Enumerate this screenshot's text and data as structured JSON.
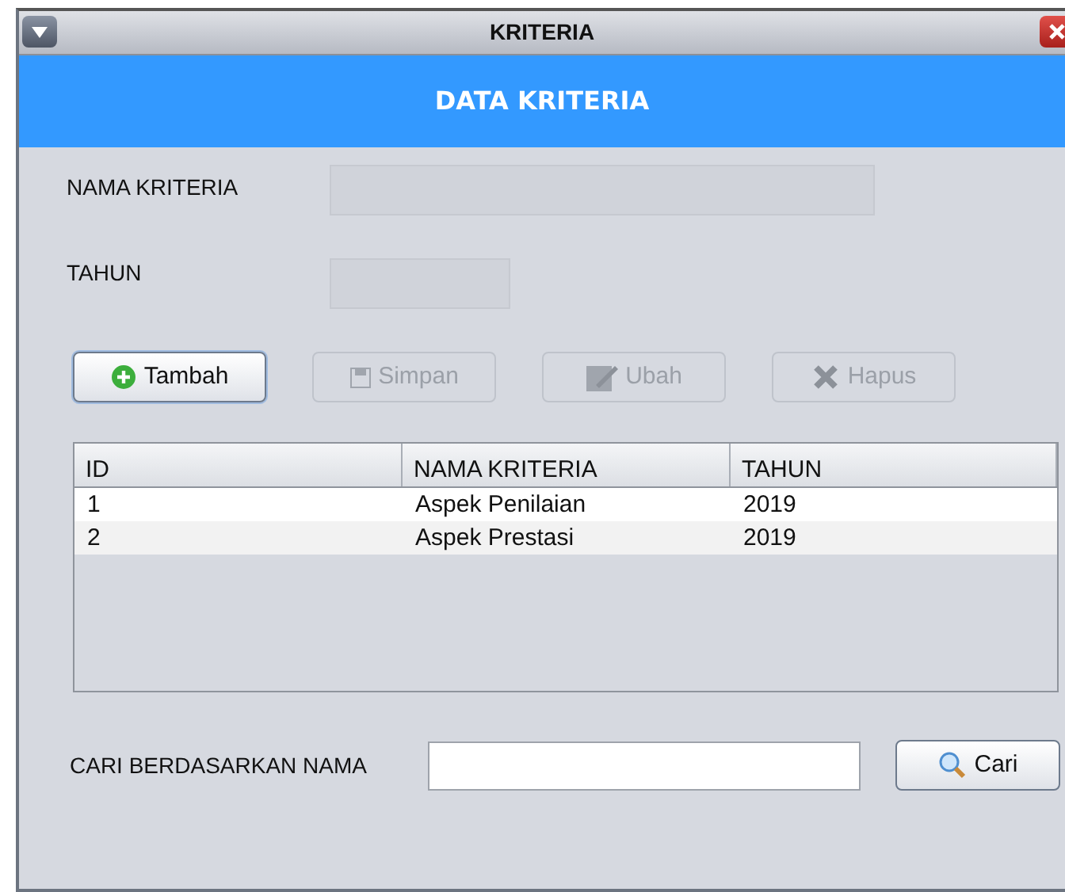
{
  "window": {
    "title": "KRITERIA"
  },
  "header": "DATA KRITERIA",
  "fields": [
    {
      "label": "NAMA KRITERIA",
      "disabled": true
    },
    {
      "label": "TAHUN",
      "disabled": true
    }
  ],
  "buttons": [
    {
      "label": "Tambah",
      "kind": "add",
      "disabled": false,
      "focused": true
    },
    {
      "label": "Simpan",
      "kind": "save",
      "disabled": true,
      "focused": false
    },
    {
      "label": "Ubah",
      "kind": "edit",
      "disabled": true,
      "focused": false
    },
    {
      "label": "Hapus",
      "kind": "delete",
      "disabled": true,
      "focused": false
    }
  ],
  "table": {
    "columns": [
      "ID",
      "NAMA KRITERIA",
      "TAHUN"
    ],
    "rows": [
      [
        "1",
        "Aspek Penilaian",
        "2019"
      ],
      [
        "2",
        "Aspek Prestasi",
        "2019"
      ]
    ]
  },
  "search": {
    "label": "CARI BERDASARKAN NAMA",
    "button": "Cari"
  }
}
